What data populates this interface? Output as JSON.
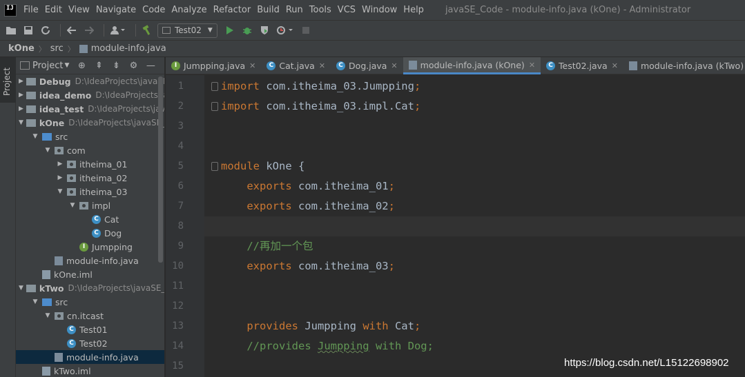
{
  "menubar": {
    "logo": "IJ",
    "items": [
      "File",
      "Edit",
      "View",
      "Navigate",
      "Code",
      "Analyze",
      "Refactor",
      "Build",
      "Run",
      "Tools",
      "VCS",
      "Window",
      "Help"
    ],
    "window_title": "javaSE_Code - module-info.java (kOne) - Administrator"
  },
  "toolbar": {
    "run_config": "Test02"
  },
  "breadcrumb": {
    "items": [
      "kOne",
      "src",
      "module-info.java"
    ]
  },
  "tool_strip": {
    "project_tab": "Project"
  },
  "project_panel": {
    "title": "Project",
    "tree": [
      {
        "name": "Debug",
        "path": "D:\\IdeaProjects\\javaSE_Code\\Debug",
        "icon": "folder-module",
        "bold": true,
        "arrow": "right",
        "depth": 0
      },
      {
        "name": "idea_demo",
        "path": "D:\\IdeaProjects\\javaSE_Code\\idea_demo",
        "icon": "folder-module",
        "bold": true,
        "arrow": "right",
        "depth": 0
      },
      {
        "name": "idea_test",
        "path": "D:\\IdeaProjects\\javaSE_Code\\idea_test",
        "icon": "folder-module",
        "bold": true,
        "arrow": "right",
        "depth": 0
      },
      {
        "name": "kOne",
        "path": "D:\\IdeaProjects\\javaSE_Code\\kOne",
        "icon": "folder-module",
        "bold": true,
        "arrow": "down",
        "depth": 0
      },
      {
        "name": "src",
        "path": "",
        "icon": "folder-src",
        "bold": false,
        "arrow": "down",
        "depth": 1
      },
      {
        "name": "com",
        "path": "",
        "icon": "package",
        "bold": false,
        "arrow": "down",
        "depth": 2
      },
      {
        "name": "itheima_01",
        "path": "",
        "icon": "package",
        "bold": false,
        "arrow": "right",
        "depth": 3
      },
      {
        "name": "itheima_02",
        "path": "",
        "icon": "package",
        "bold": false,
        "arrow": "right",
        "depth": 3
      },
      {
        "name": "itheima_03",
        "path": "",
        "icon": "package",
        "bold": false,
        "arrow": "down",
        "depth": 3
      },
      {
        "name": "impl",
        "path": "",
        "icon": "package",
        "bold": false,
        "arrow": "down",
        "depth": 4
      },
      {
        "name": "Cat",
        "path": "",
        "icon": "class",
        "bold": false,
        "arrow": "none",
        "depth": 5
      },
      {
        "name": "Dog",
        "path": "",
        "icon": "class",
        "bold": false,
        "arrow": "none",
        "depth": 5
      },
      {
        "name": "Jumpping",
        "path": "",
        "icon": "interface",
        "bold": false,
        "arrow": "none",
        "depth": 4
      },
      {
        "name": "module-info.java",
        "path": "",
        "icon": "file",
        "bold": false,
        "arrow": "none",
        "depth": 2
      },
      {
        "name": "kOne.iml",
        "path": "",
        "icon": "iml",
        "bold": false,
        "arrow": "none",
        "depth": 1
      },
      {
        "name": "kTwo",
        "path": "D:\\IdeaProjects\\javaSE_Code\\kTwo",
        "icon": "folder-module",
        "bold": true,
        "arrow": "down",
        "depth": 0
      },
      {
        "name": "src",
        "path": "",
        "icon": "folder-src",
        "bold": false,
        "arrow": "down",
        "depth": 1
      },
      {
        "name": "cn.itcast",
        "path": "",
        "icon": "package",
        "bold": false,
        "arrow": "down",
        "depth": 2
      },
      {
        "name": "Test01",
        "path": "",
        "icon": "class",
        "bold": false,
        "arrow": "none",
        "depth": 3
      },
      {
        "name": "Test02",
        "path": "",
        "icon": "class",
        "bold": false,
        "arrow": "none",
        "depth": 3
      },
      {
        "name": "module-info.java",
        "path": "",
        "icon": "file",
        "bold": false,
        "arrow": "none",
        "depth": 2,
        "selected": true
      },
      {
        "name": "kTwo.iml",
        "path": "",
        "icon": "iml",
        "bold": false,
        "arrow": "none",
        "depth": 1
      }
    ]
  },
  "editor_tabs": [
    {
      "label": "Jumpping.java",
      "icon": "interface",
      "active": false,
      "closable": true
    },
    {
      "label": "Cat.java",
      "icon": "class",
      "active": false,
      "closable": true
    },
    {
      "label": "Dog.java",
      "icon": "class",
      "active": false,
      "closable": true
    },
    {
      "label": "module-info.java (kOne)",
      "icon": "file",
      "active": true,
      "closable": true
    },
    {
      "label": "Test02.java",
      "icon": "class",
      "active": false,
      "closable": true
    },
    {
      "label": "module-info.java (kTwo)",
      "icon": "file",
      "active": false,
      "closable": true
    }
  ],
  "editor": {
    "current_line": 8,
    "lines": [
      {
        "n": "1",
        "fold": true,
        "tokens": [
          {
            "t": "import",
            "c": "kw"
          },
          {
            "t": " com.itheima_03.Jumpping"
          },
          {
            "t": ";",
            "c": "kw"
          }
        ]
      },
      {
        "n": "2",
        "fold": true,
        "tokens": [
          {
            "t": "import",
            "c": "kw"
          },
          {
            "t": " com.itheima_03.impl.Cat"
          },
          {
            "t": ";",
            "c": "kw"
          }
        ]
      },
      {
        "n": "3",
        "tokens": []
      },
      {
        "n": "4",
        "tokens": []
      },
      {
        "n": "5",
        "fold": true,
        "tokens": [
          {
            "t": "module",
            "c": "kw"
          },
          {
            "t": " kOne {"
          }
        ]
      },
      {
        "n": "6",
        "tokens": [
          {
            "t": "    "
          },
          {
            "t": "exports",
            "c": "kw"
          },
          {
            "t": " com.itheima_01"
          },
          {
            "t": ";",
            "c": "kw"
          }
        ]
      },
      {
        "n": "7",
        "tokens": [
          {
            "t": "    "
          },
          {
            "t": "exports",
            "c": "kw"
          },
          {
            "t": " com.itheima_02"
          },
          {
            "t": ";",
            "c": "kw"
          }
        ]
      },
      {
        "n": "8",
        "tokens": []
      },
      {
        "n": "9",
        "tokens": [
          {
            "t": "    "
          },
          {
            "t": "//再加一个包",
            "c": "cm"
          }
        ]
      },
      {
        "n": "10",
        "tokens": [
          {
            "t": "    "
          },
          {
            "t": "exports",
            "c": "kw"
          },
          {
            "t": " com.itheima_03"
          },
          {
            "t": ";",
            "c": "kw"
          }
        ]
      },
      {
        "n": "11",
        "tokens": []
      },
      {
        "n": "12",
        "tokens": []
      },
      {
        "n": "13",
        "tokens": [
          {
            "t": "    "
          },
          {
            "t": "provides",
            "c": "kw"
          },
          {
            "t": " Jumpping "
          },
          {
            "t": "with",
            "c": "kw"
          },
          {
            "t": " Cat"
          },
          {
            "t": ";",
            "c": "kw"
          }
        ]
      },
      {
        "n": "14",
        "tokens": [
          {
            "t": "    "
          },
          {
            "t": "//provides ",
            "c": "cm"
          },
          {
            "t": "Jumpping",
            "c": "cm squiggle"
          },
          {
            "t": " with Dog;",
            "c": "cm"
          }
        ]
      },
      {
        "n": "15",
        "tokens": []
      }
    ]
  },
  "watermark": "https://blog.csdn.net/L15122698902",
  "colors": {
    "keyword": "#cc7832",
    "comment": "#629755",
    "text": "#a9b7c6",
    "selection": "#0d293e",
    "tab_underline": "#4a88c7"
  }
}
